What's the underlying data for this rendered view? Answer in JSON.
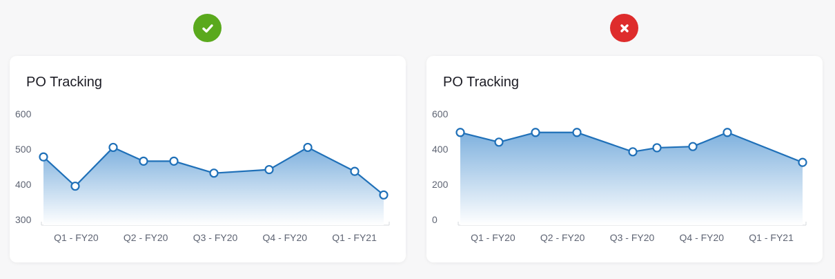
{
  "badges": {
    "good": {
      "icon": "checkmark-icon",
      "color": "#5aa91d"
    },
    "bad": {
      "icon": "close-icon",
      "color": "#de2c2c"
    }
  },
  "colors": {
    "line": "#1f70b8",
    "fill_top": "#7fb1de",
    "fill_bottom": "#ffffff",
    "axis": "#d6d9de",
    "tick_text": "#5e6473"
  },
  "chart_data": [
    {
      "type": "area",
      "title": "PO Tracking",
      "xlabel": "",
      "ylabel": "",
      "x_tick_labels": [
        "Q1 - FY20",
        "Q2 - FY20",
        "Q3 - FY20",
        "Q4 - FY20",
        "Q1 - FY21"
      ],
      "y_ticks": [
        300,
        400,
        500,
        600
      ],
      "ylim": [
        300,
        600
      ],
      "grid": false,
      "values": [
        478,
        395,
        505,
        466,
        466,
        432,
        442,
        505,
        437,
        370
      ],
      "baseline_truncated": true
    },
    {
      "type": "area",
      "title": "PO Tracking",
      "xlabel": "",
      "ylabel": "",
      "x_tick_labels": [
        "Q1 - FY20",
        "Q2 - FY20",
        "Q3 - FY20",
        "Q4 - FY20",
        "Q1 - FY21"
      ],
      "y_ticks": [
        0,
        200,
        400,
        600
      ],
      "ylim": [
        0,
        600
      ],
      "grid": false,
      "values": [
        495,
        440,
        495,
        495,
        385,
        408,
        415,
        495,
        325
      ],
      "baseline_truncated": false
    }
  ]
}
